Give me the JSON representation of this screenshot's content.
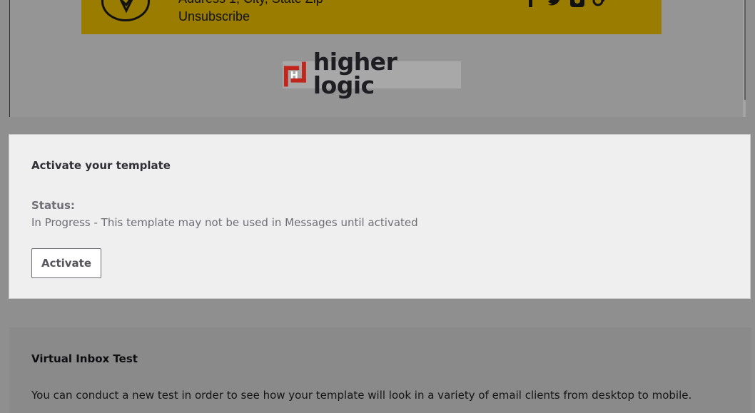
{
  "email_preview": {
    "address_line": "Address 1, City, State Zip",
    "unsubscribe_label": "Unsubscribe",
    "social_icons": [
      "facebook-icon",
      "twitter-icon",
      "instagram-icon",
      "google-plus-icon"
    ],
    "logo_text": "higher logic",
    "logo_mark": "H",
    "band_color": "#9a7d00"
  },
  "activate": {
    "title": "Activate your template",
    "status_label": "Status:",
    "status_text": "In Progress - This template may not be used in Messages until activated",
    "button_label": "Activate"
  },
  "virtual_inbox": {
    "title": "Virtual Inbox Test",
    "description": "You can conduct a new test in order to see how your template will look in a variety of email clients from desktop to mobile."
  }
}
